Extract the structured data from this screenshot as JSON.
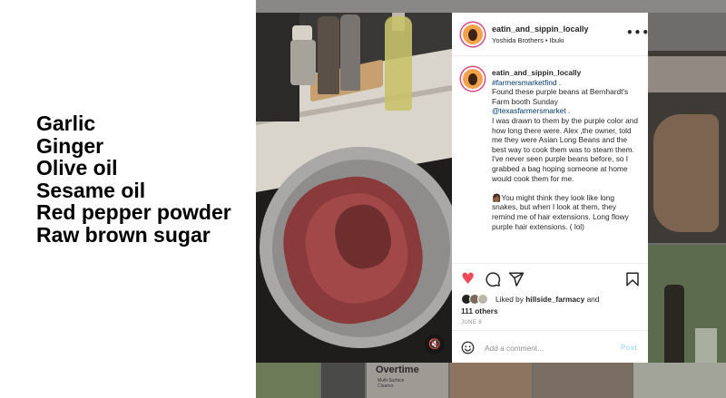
{
  "slide": {
    "ingredients": [
      "Garlic",
      "Ginger",
      "Olive oil",
      "Sesame oil",
      "Red pepper powder",
      "Raw brown sugar"
    ]
  },
  "background": {
    "tile_brand": "Overtime",
    "tile_subtext": "Multi-Surface Cleaner"
  },
  "post": {
    "header": {
      "username": "eatin_and_sippin_locally",
      "audio": "Yoshida Brothers • Ibuki",
      "more_icon": "more-horizontal-icon"
    },
    "caption": {
      "username": "eatin_and_sippin_locally",
      "hashtag": "#farmersmarketfind",
      "hashtag_suffix": " .",
      "line1": "Found these purple beans at Bernhardt's Farm booth Sunday",
      "mention": "@texasfarmersmarket",
      "mention_suffix": " .",
      "para1_rest": "I was drawn to them by the purple color and how long there were. Alex ,the owner, told me they were Asian Long Beans and the best way to cook them was to steam them. I've never seen purple beans before, so I grabbed a bag hoping someone at home would cook them for me.",
      "para2": "You might think they look like long snakes, but when I look at them, they remind me of hair extensions. Long flowy purple hair extensions. ( lol)",
      "para2_emoji": "👩🏾"
    },
    "actions": {
      "like_icon": "heart-filled-icon",
      "comment_icon": "comment-icon",
      "share_icon": "paper-plane-icon",
      "save_icon": "bookmark-icon"
    },
    "likes": {
      "prefix": "Liked by",
      "user": "hillside_farmacy",
      "connector": "and",
      "count": "111 others"
    },
    "date": "JUNE 8",
    "comment": {
      "placeholder": "Add a comment...",
      "post_label": "Post"
    },
    "video": {
      "mute_icon": "muted-speaker-icon",
      "mute_glyph": "🔇"
    },
    "colors": {
      "like_red": "#ed4956",
      "link_blue": "#00376b",
      "post_disabled": "#b2dffc"
    }
  }
}
